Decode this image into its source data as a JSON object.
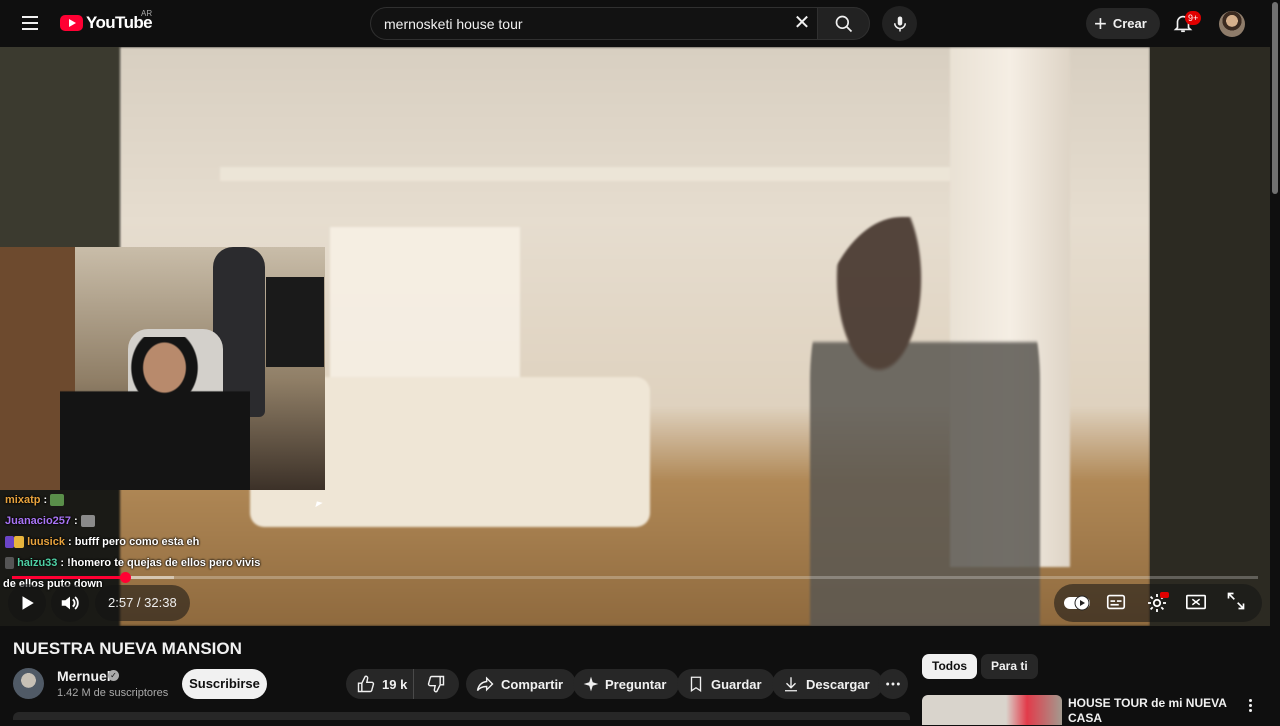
{
  "header": {
    "logo_text": "YouTube",
    "country_code": "AR",
    "search_value": "mernosketi house tour",
    "create_label": "Crear",
    "notification_count": "9+"
  },
  "player": {
    "current_time": "2:57",
    "duration": "32:38",
    "time_display": "2:57 / 32:38",
    "progress_fraction": 0.0905,
    "buffered_fraction": 0.13,
    "accent_color": "#ff0033"
  },
  "chat": [
    {
      "user": "mixatp",
      "user_color": "#e8a33d",
      "separator": ":",
      "message": "",
      "emote": true
    },
    {
      "user": "Juanacio257",
      "user_color": "#a874f5",
      "separator": ":",
      "message": "",
      "emote": true
    },
    {
      "user": "luusick",
      "user_color": "#e8a33d",
      "separator": ":",
      "message": "bufff pero como esta eh",
      "badge": true
    },
    {
      "user": "haizu33",
      "user_color": "#4fd1a5",
      "separator": ":",
      "message": "!homero te quejas de ellos pero vivis",
      "badge": true
    },
    {
      "user": "",
      "user_color": "#ffffff",
      "separator": "",
      "message": "de ellos puto down"
    }
  ],
  "video": {
    "title": "NUESTRA NUEVA MANSION",
    "channel_name": "Mernuel",
    "subscribers": "1.42 M de suscriptores",
    "subscribe_label": "Suscribirse",
    "likes": "19 k",
    "share_label": "Compartir",
    "ask_label": "Preguntar",
    "save_label": "Guardar",
    "download_label": "Descargar"
  },
  "sidebar": {
    "chips": [
      "Todos",
      "Para ti"
    ],
    "active_chip": "Todos",
    "recommendation_title": "HOUSE TOUR de mi NUEVA CASA"
  }
}
